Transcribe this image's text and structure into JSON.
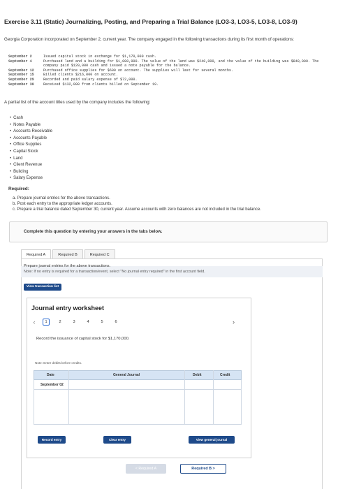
{
  "exercise": {
    "title": "Exercise 3.11 (Static) Journalizing, Posting, and Preparing a Trial Balance (LO3-3, LO3-5, LO3-8, LO3-9)",
    "intro": "Georgia Corporation incorporated on September 2, current year. The company engaged in the following transactions during its first month of operations:"
  },
  "transactions": [
    {
      "date": "September 2",
      "text": "Issued capital stock in exchange for $1,170,000 cash."
    },
    {
      "date": "September 4",
      "text": "Purchased land and a building for $1,080,000. The value of the land was $240,000, and the value of the building was $840,000. The company paid $120,000 cash and issued a note payable for the balance."
    },
    {
      "date": "September 12",
      "text": "Purchased office supplies for $600 on account. The supplies will last for several months."
    },
    {
      "date": "September 15",
      "text": "Billed clients $216,000 on account."
    },
    {
      "date": "September 29",
      "text": "Recorded and paid salary expense of $72,000."
    },
    {
      "date": "September 30",
      "text": "Received $132,000 from clients billed on September 19."
    }
  ],
  "accounts_intro": "A partial list of the account titles used by the company includes the following:",
  "accounts": [
    "Cash",
    "Notes Payable",
    "Accounts Receivable",
    "Accounts Payable",
    "Office Supplies",
    "Capital Stock",
    "Land",
    "Client Revenue",
    "Building",
    "Salary Expense"
  ],
  "required": {
    "heading": "Required:",
    "items": [
      "a. Prepare journal entries for the above transactions.",
      "b. Post each entry to the appropriate ledger accounts.",
      "c. Prepare a trial balance dated September 30, current year. Assume accounts with zero balances are not included in the trial balance."
    ]
  },
  "complete_instruction": "Complete this question by entering your answers in the tabs below.",
  "tabs": [
    "Required A",
    "Required B",
    "Required C"
  ],
  "panel": {
    "prepare": "Prepare journal entries for the above transactions.",
    "note": "Note: If no entry is required for a transaction/event, select \"No journal entry required\" in the first account field.",
    "view_transaction_list": "View transaction list"
  },
  "worksheet": {
    "title": "Journal entry worksheet",
    "pages": [
      "1",
      "2",
      "3",
      "4",
      "5",
      "6"
    ],
    "record_text": "Record the issuance of capital stock for $1,170,000.",
    "enter_note": "Note: Enter debits before credits.",
    "columns": {
      "date": "Date",
      "general_journal": "General Journal",
      "debit": "Debit",
      "credit": "Credit"
    },
    "row_date": "September 02",
    "record_entry": "Record entry",
    "clear_entry": "Clear entry",
    "view_general_journal": "View general journal"
  },
  "nav": {
    "prev": "< Required A",
    "next": "Required B >"
  }
}
